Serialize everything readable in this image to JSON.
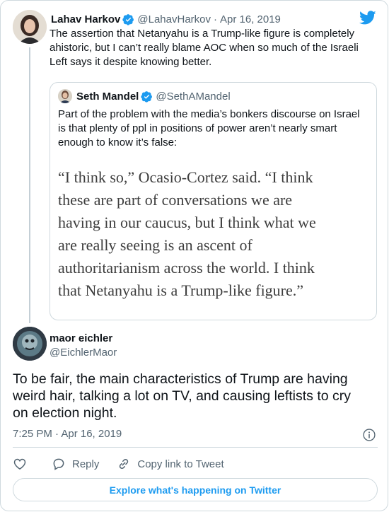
{
  "parent": {
    "name": "Lahav Harkov",
    "handle": "@LahavHarkov",
    "separator": "·",
    "date": "Apr 16, 2019",
    "text_lines": [
      "The assertion that Netanyahu is a Trump-like figure is completely",
      "ahistoric, but I can’t really blame AOC when so much of the Israeli",
      "Left says it despite knowing better."
    ]
  },
  "quote": {
    "name": "Seth Mandel",
    "handle": "@SethAMandel",
    "text_lines": [
      "Part of the problem with the media’s bonkers discourse on Israel",
      "is that plenty of ppl in positions of power aren’t nearly smart",
      "enough to know it’s false:"
    ],
    "image_lines": [
      "“I think so,” Ocasio-Cortez said. “I think",
      "these are part of conversations we are",
      "having in our caucus, but I think what we",
      "are really seeing is an ascent of",
      "authoritarianism across the world. I think",
      "that Netanyahu is a Trump-like figure.”"
    ]
  },
  "main": {
    "name": "maor eichler",
    "handle": "@EichlerMaor",
    "text_lines": [
      "To be fair, the main characteristics of Trump are having",
      "weird hair, talking a lot on TV, and causing leftists to cry",
      "on election night."
    ],
    "timestamp": "7:25 PM · Apr 16, 2019"
  },
  "actions": {
    "reply_label": "Reply",
    "copy_label": "Copy link to Tweet"
  },
  "explore_label": "Explore what's happening on Twitter",
  "colors": {
    "accent": "#1d9bf0",
    "like_icon": "#536471",
    "verified": "#1d9bf0"
  },
  "icons": {
    "logo": "twitter-bird-icon",
    "verified": "verified-badge-icon",
    "info": "info-icon",
    "like": "heart-icon",
    "reply": "speech-bubble-icon",
    "copy": "link-icon"
  }
}
